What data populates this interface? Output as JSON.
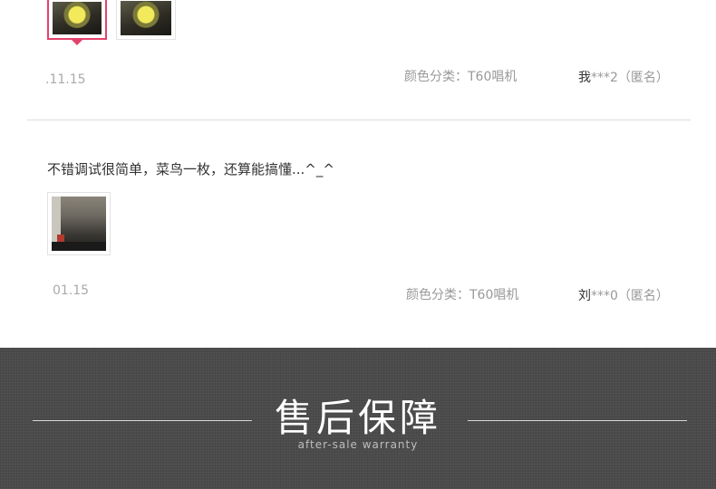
{
  "reviews": [
    {
      "date": ".11.15",
      "variant": "颜色分类：T60唱机",
      "user_name": "我",
      "user_masked": "***2",
      "user_anon": "（匿名）",
      "images": [
        "vinyl-record-photo",
        "vinyl-record-photo"
      ]
    },
    {
      "text": "不错调试很简单，菜鸟一枚，还算能搞懂...^_^",
      "date": "01.15",
      "variant": "颜色分类：T60唱机",
      "user_name": "刘",
      "user_masked": "***0",
      "user_anon": "（匿名）",
      "images": [
        "turntable-photo"
      ]
    }
  ],
  "banner": {
    "title": "售后保障",
    "subtitle": "after-sale warranty"
  }
}
